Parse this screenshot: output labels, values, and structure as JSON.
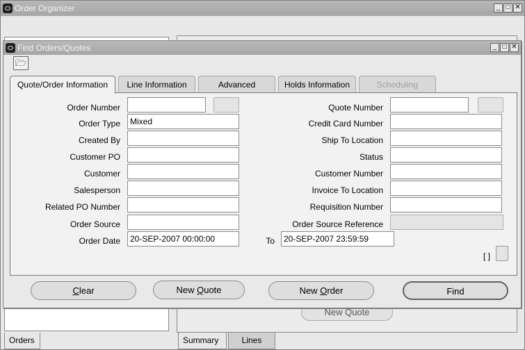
{
  "organizer": {
    "title": "Order Organizer",
    "bg_button": "New Quote",
    "left_tab": "Orders",
    "tabs": [
      "Summary",
      "Lines"
    ]
  },
  "find": {
    "title": "Find  Orders/Quotes",
    "tool_icon": "open-folder-icon",
    "tabs": [
      {
        "label": "Quote/Order Information",
        "state": "active"
      },
      {
        "label": "Line Information",
        "state": "normal"
      },
      {
        "label": "Advanced",
        "state": "normal"
      },
      {
        "label": "Holds Information",
        "state": "normal"
      },
      {
        "label": "Scheduling",
        "state": "disabled"
      }
    ],
    "left_fields": {
      "order_number": {
        "label": "Order Number",
        "value": ""
      },
      "order_type": {
        "label": "Order Type",
        "value": "Mixed"
      },
      "created_by": {
        "label": "Created By",
        "value": ""
      },
      "customer_po": {
        "label": "Customer PO",
        "value": ""
      },
      "customer": {
        "label": "Customer",
        "value": ""
      },
      "salesperson": {
        "label": "Salesperson",
        "value": ""
      },
      "related_po": {
        "label": "Related PO Number",
        "value": ""
      },
      "order_source": {
        "label": "Order Source",
        "value": ""
      },
      "order_date": {
        "label": "Order Date",
        "value": "20-SEP-2007 00:00:00"
      }
    },
    "right_fields": {
      "quote_number": {
        "label": "Quote Number",
        "value": ""
      },
      "credit_card": {
        "label": "Credit Card Number",
        "value": ""
      },
      "ship_to": {
        "label": "Ship To Location",
        "value": ""
      },
      "status": {
        "label": "Status",
        "value": ""
      },
      "customer_number": {
        "label": "Customer Number",
        "value": ""
      },
      "invoice_to": {
        "label": "Invoice To Location",
        "value": ""
      },
      "requisition": {
        "label": "Requisition Number",
        "value": ""
      },
      "order_source_ref": {
        "label": "Order Source Reference",
        "value": ""
      },
      "to_date": {
        "label": "To",
        "value": "20-SEP-2007 23:59:59"
      }
    },
    "bracket": "[ ]",
    "buttons": {
      "clear": {
        "mnemonic": "C",
        "rest": "lear"
      },
      "new_quote": {
        "pre": "New ",
        "mnemonic": "Q",
        "rest": "uote"
      },
      "new_order": {
        "pre": "New ",
        "mnemonic": "O",
        "rest": "rder"
      },
      "find": "Find"
    }
  },
  "window_controls": [
    "minimize-icon",
    "maximize-icon",
    "close-icon"
  ]
}
